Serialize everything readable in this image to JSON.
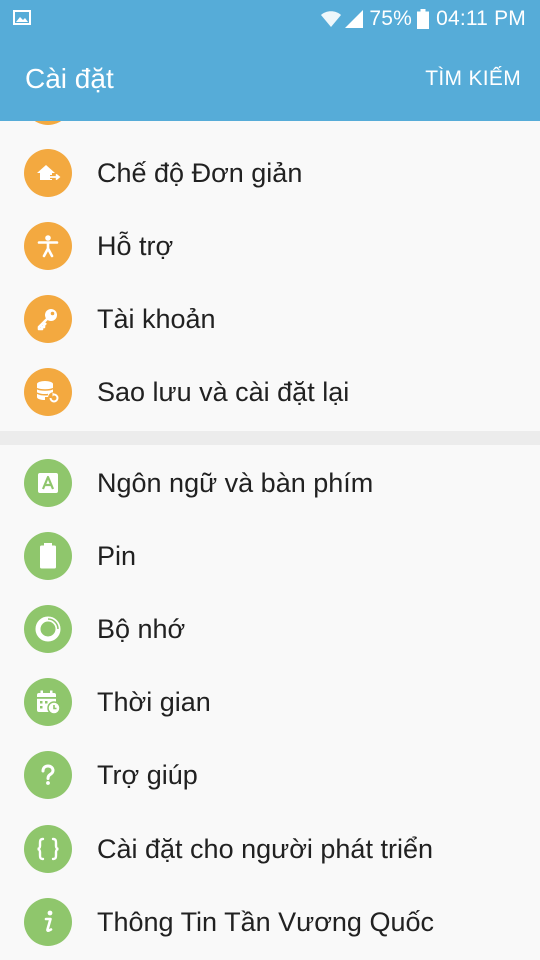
{
  "status_bar": {
    "battery_text": "75%",
    "time": "04:11 PM",
    "icons": [
      "gallery-icon",
      "wifi-icon",
      "signal-icon",
      "battery-icon"
    ]
  },
  "app_bar": {
    "title": "Cài đặt",
    "search_label": "TÌM KIẾM"
  },
  "colors": {
    "app_bar": "#56acd8",
    "orange_icon": "#f3a940",
    "green_icon": "#8fc66c"
  },
  "group1": [
    {
      "label": "Chế độ Đơn giản",
      "icon": "home-icon"
    },
    {
      "label": "Hỗ trợ",
      "icon": "accessibility-icon"
    },
    {
      "label": "Tài khoản",
      "icon": "key-icon"
    },
    {
      "label": "Sao lưu và cài đặt lại",
      "icon": "backup-icon"
    }
  ],
  "group2": [
    {
      "label": "Ngôn ngữ và bàn phím",
      "icon": "language-icon"
    },
    {
      "label": "Pin",
      "icon": "battery-icon"
    },
    {
      "label": "Bộ nhớ",
      "icon": "storage-icon"
    },
    {
      "label": "Thời gian",
      "icon": "calendar-icon"
    },
    {
      "label": "Trợ giúp",
      "icon": "help-icon"
    },
    {
      "label": "Cài đặt cho người phát triển",
      "icon": "developer-icon"
    },
    {
      "label": "Thông Tin Tần Vương Quốc",
      "icon": "info-icon"
    }
  ]
}
